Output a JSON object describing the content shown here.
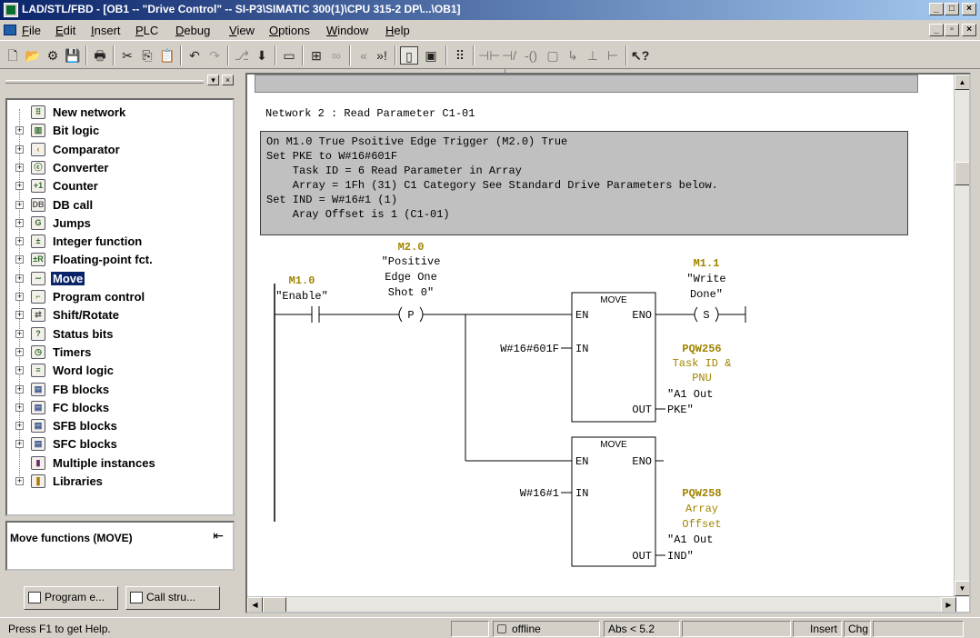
{
  "window": {
    "title": "LAD/STL/FBD  - [OB1 -- \"Drive Control\" -- SI-P3\\SIMATIC 300(1)\\CPU 315-2 DP\\...\\OB1]"
  },
  "menu": [
    "File",
    "Edit",
    "Insert",
    "PLC",
    "Debug",
    "View",
    "Options",
    "Window",
    "Help"
  ],
  "catalog": {
    "items": [
      {
        "label": "New network",
        "icon": "new-network-icon",
        "expandable": false
      },
      {
        "label": "Bit logic",
        "icon": "bit-logic-icon",
        "expandable": true
      },
      {
        "label": "Comparator",
        "icon": "comparator-icon",
        "expandable": true
      },
      {
        "label": "Converter",
        "icon": "converter-icon",
        "expandable": true
      },
      {
        "label": "Counter",
        "icon": "counter-icon",
        "expandable": true
      },
      {
        "label": "DB call",
        "icon": "db-call-icon",
        "expandable": true
      },
      {
        "label": "Jumps",
        "icon": "jumps-icon",
        "expandable": true
      },
      {
        "label": "Integer function",
        "icon": "integer-function-icon",
        "expandable": true
      },
      {
        "label": "Floating-point fct.",
        "icon": "floating-point-icon",
        "expandable": true
      },
      {
        "label": "Move",
        "icon": "move-icon",
        "expandable": true,
        "selected": true
      },
      {
        "label": "Program control",
        "icon": "program-control-icon",
        "expandable": true
      },
      {
        "label": "Shift/Rotate",
        "icon": "shift-rotate-icon",
        "expandable": true
      },
      {
        "label": "Status bits",
        "icon": "status-bits-icon",
        "expandable": true
      },
      {
        "label": "Timers",
        "icon": "timers-icon",
        "expandable": true
      },
      {
        "label": "Word logic",
        "icon": "word-logic-icon",
        "expandable": true
      },
      {
        "label": "FB blocks",
        "icon": "fb-blocks-icon",
        "expandable": true
      },
      {
        "label": "FC blocks",
        "icon": "fc-blocks-icon",
        "expandable": true
      },
      {
        "label": "SFB blocks",
        "icon": "sfb-blocks-icon",
        "expandable": true
      },
      {
        "label": "SFC blocks",
        "icon": "sfc-blocks-icon",
        "expandable": true
      },
      {
        "label": "Multiple instances",
        "icon": "multiple-instances-icon",
        "expandable": false
      },
      {
        "label": "Libraries",
        "icon": "libraries-icon",
        "expandable": true
      }
    ],
    "info": "Move functions (MOVE)",
    "tabs": [
      "Program e...",
      "Call stru..."
    ]
  },
  "network": {
    "title": "Network 2 : Read Parameter C1-01",
    "comment": [
      "On M1.0 True Psoitive Edge Trigger (M2.0) True",
      "Set PKE to W#16#601F",
      "    Task ID = 6 Read Parameter in Array",
      "    Array = 1Fh (31) C1 Category See Standard Drive Parameters below.",
      "Set IND = W#16#1 (1)",
      "    Aray Offset is 1 (C1-01)"
    ]
  },
  "ladder": {
    "contact": {
      "address": "M1.0",
      "symbol": "\"Enable\""
    },
    "edge": {
      "address": "M2.0",
      "symbol": [
        "\"Positive",
        "Edge One",
        "Shot 0\""
      ],
      "glyph": "P"
    },
    "coil": {
      "address": "M1.1",
      "symbol": [
        "\"Write",
        "Done\""
      ],
      "glyph": "S"
    },
    "move1": {
      "title": "MOVE",
      "en": "EN",
      "eno": "ENO",
      "in": "IN",
      "out": "OUT",
      "in_value": "W#16#601F",
      "out_address": "PQW256",
      "out_comment": [
        "Task ID &",
        "PNU"
      ],
      "out_symbol": [
        "\"A1 Out",
        "PKE\""
      ]
    },
    "move2": {
      "title": "MOVE",
      "en": "EN",
      "eno": "ENO",
      "in": "IN",
      "out": "OUT",
      "in_value": "W#16#1",
      "out_address": "PQW258",
      "out_comment": [
        "Array",
        "Offset"
      ],
      "out_symbol": [
        "\"A1 Out",
        "IND\""
      ]
    }
  },
  "status": {
    "help": "Press F1 to get Help.",
    "mode": "offline",
    "version": "Abs < 5.2",
    "insert": "Insert",
    "chg": "Chg"
  },
  "colors": {
    "address_highlight": "#a08400",
    "selection": "#0a246a"
  }
}
